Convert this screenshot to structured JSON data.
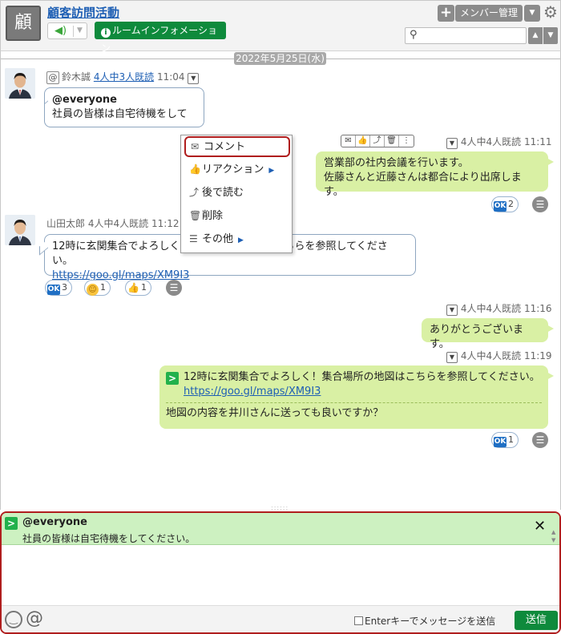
{
  "header": {
    "room_icon_char": "顧",
    "room_title": "顧客訪問活動",
    "room_info_button": "ルームインフォメーション",
    "member_button": "メンバー管理",
    "search_placeholder": ""
  },
  "date_separator": "2022年5月25日(水)",
  "messages": [
    {
      "side": "left",
      "sender": "鈴木誠",
      "read_status": "4人中3人既読",
      "time": "11:04",
      "mention": "@everyone",
      "body": "社員の皆様は自宅待機をして"
    },
    {
      "side": "right",
      "read_status": "4人中4人既読",
      "time": "11:11",
      "lines": [
        "営業部の社内会議を行います。",
        "佐藤さんと近藤さんは都合により出席します。"
      ],
      "reactions": [
        {
          "type": "ok",
          "count": "2"
        }
      ]
    },
    {
      "side": "left",
      "sender": "山田太郎",
      "read_status": "4人中4人既読",
      "time": "11:12",
      "body": "12時に玄関集合でよろしく！集合場所の地図はこちらを参照してください。",
      "link": "https://goo.gl/maps/XM9I3",
      "reactions": [
        {
          "type": "ok",
          "count": "3"
        },
        {
          "type": "smile",
          "count": "1"
        },
        {
          "type": "thumb",
          "count": "1"
        }
      ]
    },
    {
      "side": "right",
      "read_status": "4人中4人既読",
      "time": "11:16",
      "body": "ありがとうございます。"
    },
    {
      "side": "right",
      "read_status": "4人中4人既読",
      "time": "11:19",
      "quote": "12時に玄関集合でよろしく！集合場所の地図はこちらを参照してください。",
      "quote_link": "https://goo.gl/maps/XM9I3",
      "reply": "地図の内容を井川さんに送っても良いですか？",
      "reactions": [
        {
          "type": "ok",
          "count": "1"
        }
      ]
    }
  ],
  "context_menu": {
    "items": [
      "コメント",
      "リアクション",
      "後で読む",
      "削除",
      "その他"
    ]
  },
  "composer": {
    "reply_mention": "@everyone",
    "reply_body": "社員の皆様は自宅待機をしてください。",
    "enter_to_send_label": "Enterキーでメッセージを送信",
    "send_button": "送信"
  },
  "colors": {
    "accent_green": "#0e8a3c",
    "bubble_green": "#d9f0a4",
    "link_blue": "#1e5fb4",
    "highlight_red": "#b01e1e"
  }
}
